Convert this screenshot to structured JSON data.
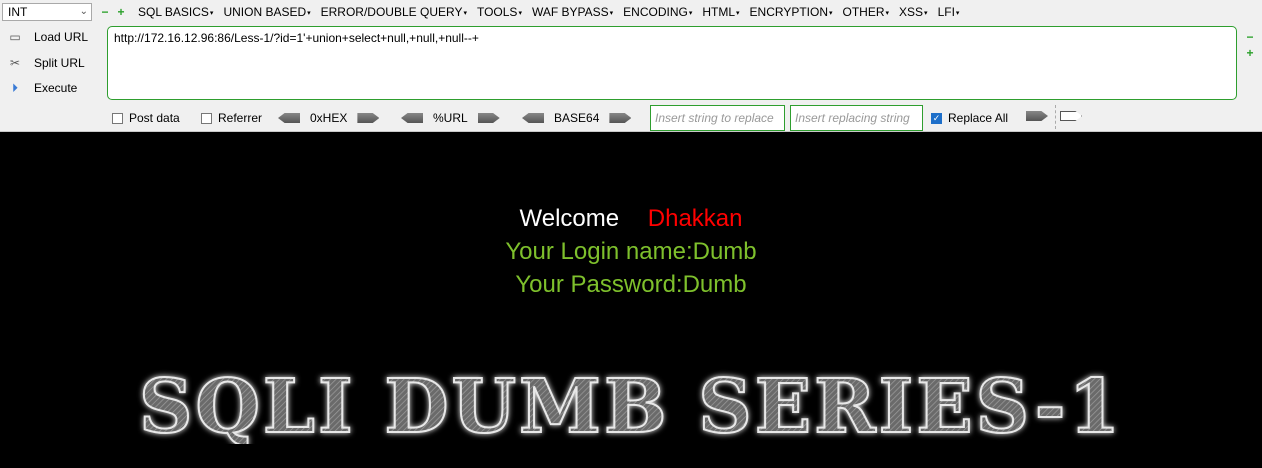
{
  "toolbar": {
    "select_value": "INT",
    "menus": [
      "SQL BASICS",
      "UNION BASED",
      "ERROR/DOUBLE QUERY",
      "TOOLS",
      "WAF BYPASS",
      "ENCODING",
      "HTML",
      "ENCRYPTION",
      "OTHER",
      "XSS",
      "LFI"
    ],
    "load_url": "Load URL",
    "split_url": "Split URL",
    "execute": "Execute",
    "url": "http://172.16.12.96:86/Less-1/?id=1'+union+select+null,+null,+null--+",
    "post_data": "Post data",
    "referrer": "Referrer",
    "hex": "0xHEX",
    "url_enc": "%URL",
    "base64": "BASE64",
    "replace_placeholder": "Insert string to replace",
    "replacing_placeholder": "Insert replacing string",
    "replace_all": "Replace All",
    "replace_all_checked": true,
    "accent_color": "#2e9e2e"
  },
  "page": {
    "welcome": "Welcome",
    "name": "Dhakkan",
    "login_line": "Your Login name:Dumb",
    "password_line": "Your Password:Dumb",
    "banner": "SQLI DUMB SERIES-1",
    "name_color": "#ff0000",
    "text_color": "#7ec02c"
  }
}
